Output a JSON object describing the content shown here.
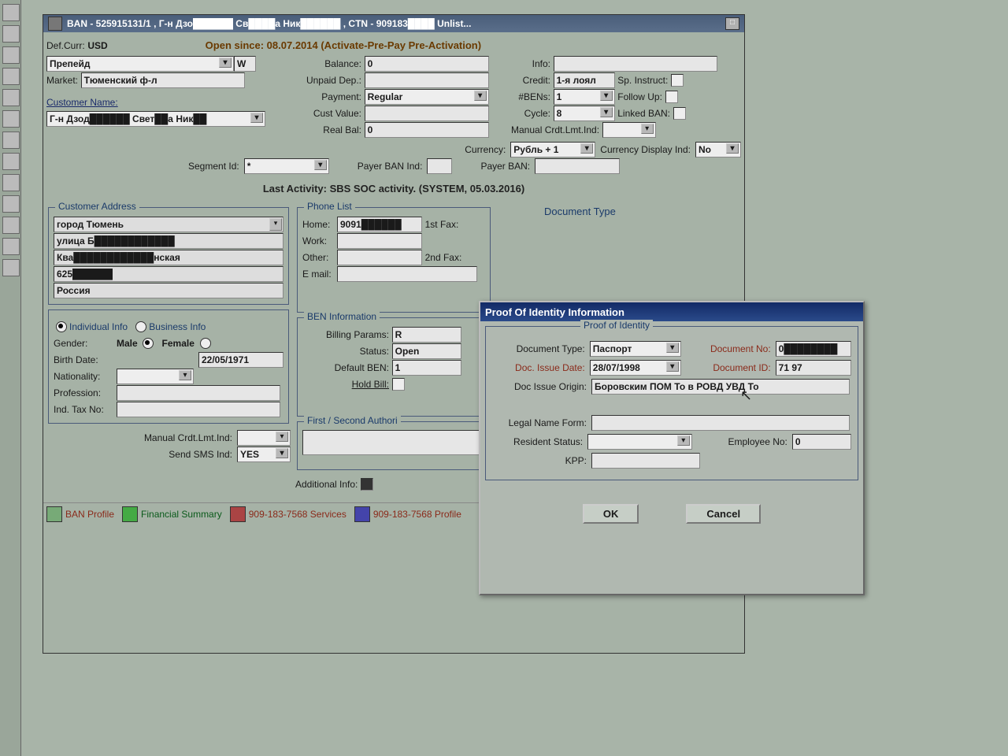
{
  "window": {
    "title": "BAN - 525915131/1 , Г-н Дзо██████ Св████а Ник██████ , CTN - 909183████ Unlist..."
  },
  "header": {
    "def_curr_label": "Def.Curr:",
    "def_curr_value": "USD",
    "open_since": "Open since: 08.07.2014 (Activate-Pre-Pay Pre-Activation)",
    "plan_value": "Препейд",
    "plan_suffix": "W",
    "market_label": "Market:",
    "market_value": "Тюменский ф-л",
    "customer_name_label": "Customer Name:",
    "customer_name_value": "Г-н Дзод██████ Свет██а Ник██",
    "balance_label": "Balance:",
    "balance_value": "0",
    "unpaid_dep_label": "Unpaid Dep.:",
    "unpaid_dep_value": "",
    "payment_label": "Payment:",
    "payment_value": "Regular",
    "cust_value_label": "Cust Value:",
    "cust_value_value": "",
    "real_bal_label": "Real Bal:",
    "real_bal_value": "0",
    "info_label": "Info:",
    "credit_label": "Credit:",
    "credit_value": "1-я лоял",
    "sp_instruct_label": "Sp. Instruct:",
    "bens_label": "#BENs:",
    "bens_value": "1",
    "follow_up_label": "Follow Up:",
    "cycle_label": "Cycle:",
    "cycle_value": "8",
    "linked_ban_label": "Linked BAN:",
    "manual_crdt_label": "Manual Crdt.Lmt.Ind:",
    "currency_label": "Currency:",
    "currency_value": "Рубль + 1",
    "currency_display_label": "Currency Display Ind:",
    "currency_display_value": "No",
    "segment_id_label": "Segment Id:",
    "segment_id_value": "*",
    "payer_ban_ind_label": "Payer BAN Ind:",
    "payer_ban_label": "Payer BAN:"
  },
  "activity": "Last Activity: SBS SOC activity. (SYSTEM, 05.03.2016)",
  "address": {
    "legend": "Customer Address",
    "line1": "город Тюмень",
    "line2": "улица Б████████████",
    "line3": "  Ква████████████нская",
    "line4": "625██████",
    "line5": "Россия"
  },
  "phone": {
    "legend": "Phone List",
    "home_label": "Home:",
    "home_value": "9091██████",
    "work_label": "Work:",
    "other_label": "Other:",
    "email_label": "E mail:",
    "fax1_label": "1st Fax:",
    "fax2_label": "2nd Fax:"
  },
  "doctype_label": "Document Type",
  "info_group": {
    "individual_label": "Individual Info",
    "business_label": "Business Info",
    "gender_label": "Gender:",
    "male_label": "Male",
    "female_label": "Female",
    "birth_label": "Birth Date:",
    "birth_value": "22/05/1971",
    "nationality_label": "Nationality:",
    "profession_label": "Profession:",
    "ind_tax_label": "Ind. Tax No:"
  },
  "ben": {
    "legend": "BEN Information",
    "billing_label": "Billing Params:",
    "billing_value": "R",
    "status_label": "Status:",
    "status_value": "Open",
    "default_ben_label": "Default BEN:",
    "default_ben_value": "1",
    "hold_bill_label": "Hold Bill:"
  },
  "authori_legend": "First / Second  Authori",
  "bottom_ctrl": {
    "manual_crdt_label": "Manual Crdt.Lmt.Ind:",
    "send_sms_label": "Send SMS Ind:",
    "send_sms_value": "YES",
    "additional_info_label": "Additional Info:"
  },
  "bottombar": {
    "ban_profile": "BAN Profile",
    "fin_summary": "Financial Summary",
    "services": "909-183-7568 Services",
    "profile": "909-183-7568 Profile"
  },
  "modal": {
    "title": "Proof Of Identity Information",
    "legend": "Proof of Identity",
    "doc_type_label": "Document Type:",
    "doc_type_value": "Паспорт",
    "doc_no_label": "Document No:",
    "doc_no_value": "0████████",
    "issue_date_label": "Doc. Issue Date:",
    "issue_date_value": "28/07/1998",
    "doc_id_label": "Document ID:",
    "doc_id_value": "71 97",
    "issue_origin_label": "Doc Issue Origin:",
    "issue_origin_value": "Боровским ПОМ То в РОВД УВД То",
    "legal_name_label": "Legal Name Form:",
    "resident_label": "Resident Status:",
    "employee_no_label": "Employee No:",
    "employee_no_value": "0",
    "kpp_label": "KPP:",
    "ok": "OK",
    "cancel": "Cancel"
  }
}
